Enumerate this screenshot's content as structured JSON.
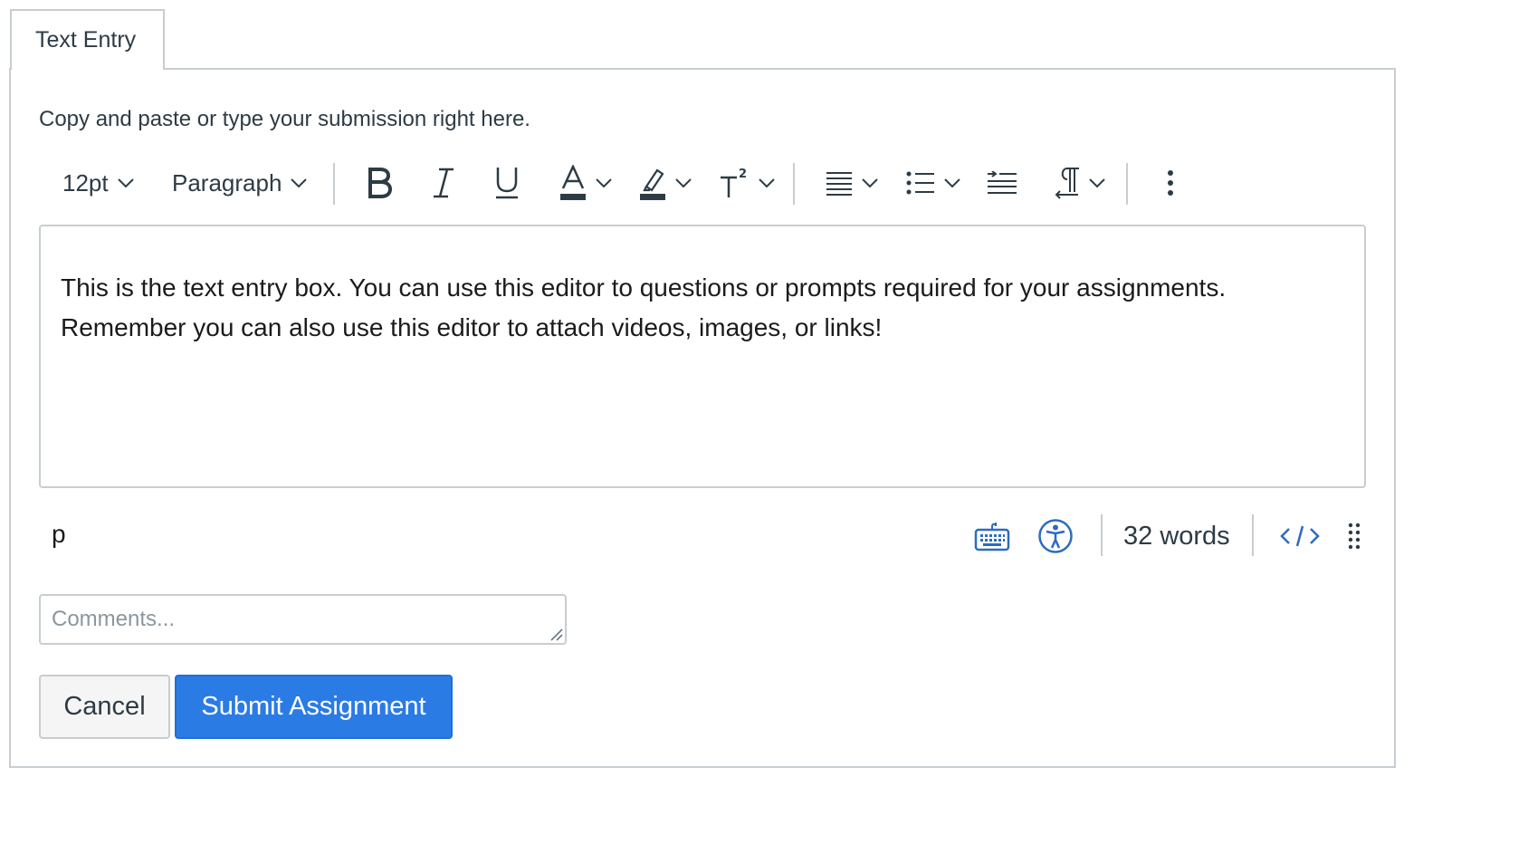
{
  "tab": {
    "label": "Text Entry"
  },
  "instructions": "Copy and paste or type your submission right here.",
  "toolbar": {
    "font_size": "12pt",
    "block_format": "Paragraph",
    "icons": [
      "bold-icon",
      "italic-icon",
      "underline-icon",
      "text-color-icon",
      "highlight-icon",
      "superscript-icon",
      "align-icon",
      "list-icon",
      "indent-icon",
      "text-direction-icon",
      "more-icon"
    ]
  },
  "editor": {
    "line1": "This is the text entry box. You can use this editor to questions or prompts required for your assignments.",
    "line2": "Remember you can also use this editor to attach videos, images, or links!"
  },
  "statusbar": {
    "path": "p",
    "word_count": "32 words"
  },
  "comments": {
    "placeholder": "Comments..."
  },
  "buttons": {
    "cancel": "Cancel",
    "submit": "Submit Assignment"
  },
  "colors": {
    "primary": "#2b7be5",
    "icon_blue": "#2c6cbf",
    "border": "#c7cdd1",
    "text": "#2d3b45"
  }
}
